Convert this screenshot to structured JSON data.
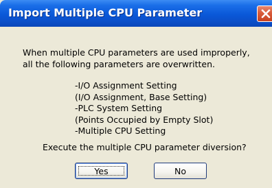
{
  "window": {
    "title": "Import Multiple CPU Parameter",
    "close_icon": "close-icon"
  },
  "message": {
    "line1": "When multiple CPU parameters are used improperly,",
    "line2": "all the following parameters are overwritten."
  },
  "parameters": [
    "-I/O Assignment Setting",
    "(I/O Assignment, Base Setting)",
    "-PLC System Setting",
    "(Points Occupied by Empty Slot)",
    "-Multiple CPU Setting"
  ],
  "question": "Execute the multiple CPU parameter diversion?",
  "buttons": {
    "yes": "Yes",
    "no": "No"
  },
  "colors": {
    "titlebar": "#0a58d8",
    "close": "#d85b3a",
    "body": "#ece9d8"
  }
}
